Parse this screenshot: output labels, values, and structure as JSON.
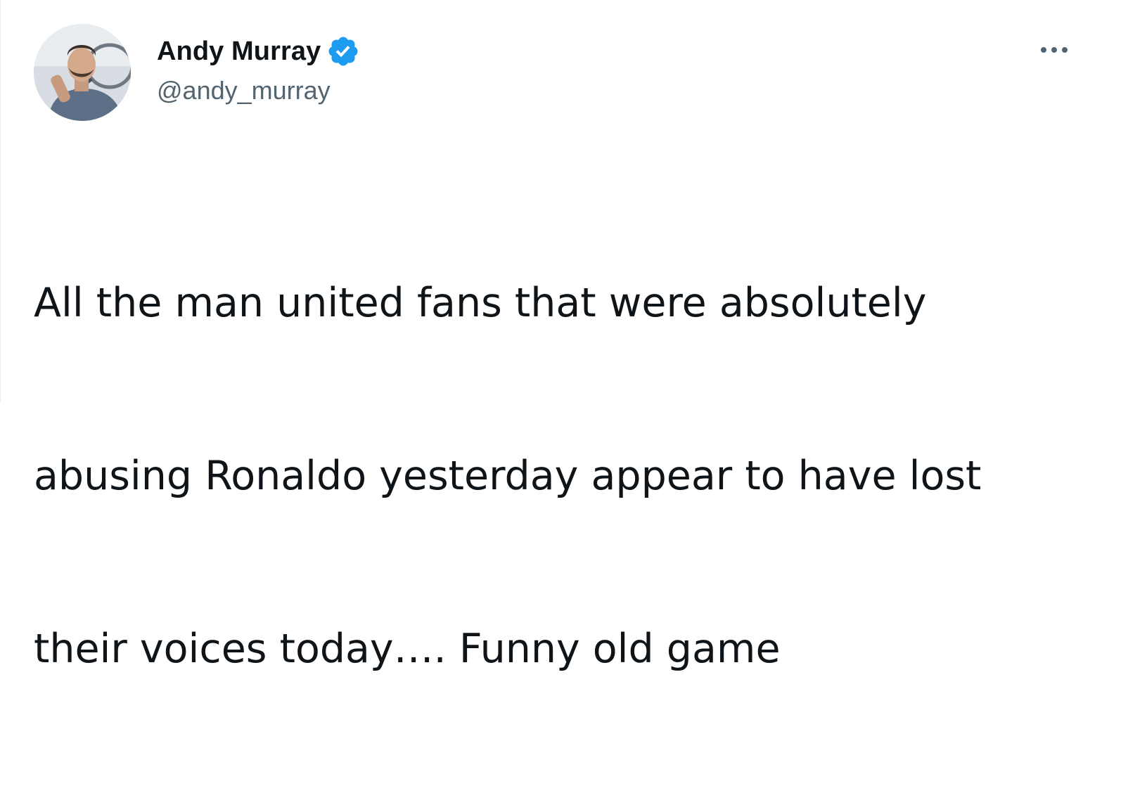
{
  "tweet": {
    "author": {
      "display_name": "Andy Murray",
      "handle": "@andy_murray",
      "verified": true,
      "avatar_icon": "profile-photo"
    },
    "text_lines": [
      "All the man united fans that were absolutely",
      "abusing Ronaldo yesterday appear to have lost",
      "their voices today…. Funny old game"
    ],
    "more_icon": "more-options-icon"
  },
  "colors": {
    "verified_blue": "#1d9bf0",
    "text_primary": "#0f1419",
    "text_secondary": "#536471",
    "icon_gray": "#536471"
  }
}
